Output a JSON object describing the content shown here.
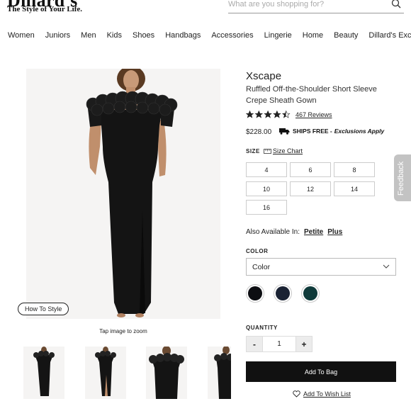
{
  "header": {
    "logo_text": "Dillard's",
    "logo_tagline": "The Style of Your Life.",
    "search_placeholder": "What are you shopping for?"
  },
  "nav": [
    "Women",
    "Juniors",
    "Men",
    "Kids",
    "Shoes",
    "Handbags",
    "Accessories",
    "Lingerie",
    "Home",
    "Beauty",
    "Dillard's Exclusive"
  ],
  "gallery": {
    "how_to_style": "How To Style",
    "tap_to_zoom": "Tap image to zoom"
  },
  "product": {
    "brand": "Xscape",
    "name": "Ruffled Off-the-Shoulder Short Sleeve Crepe Sheath Gown",
    "rating": 4.5,
    "reviews": "467 Reviews",
    "price": "$228.00",
    "shipping": "SHIPS FREE -",
    "shipping_note": "Exclusions Apply"
  },
  "size": {
    "label": "SIZE",
    "chart_label": "Size Chart",
    "options": [
      "4",
      "6",
      "8",
      "10",
      "12",
      "14",
      "16"
    ]
  },
  "also_available": {
    "label": "Also Available In:",
    "options": [
      "Petite",
      "Plus"
    ]
  },
  "color": {
    "label": "COLOR",
    "select_value": "Color",
    "swatches": [
      "#0d0e12",
      "#1a2233",
      "#0f3a3a"
    ]
  },
  "quantity": {
    "label": "QUANTITY",
    "minus": "-",
    "value": "1",
    "plus": "+"
  },
  "actions": {
    "add_to_bag": "Add To Bag",
    "wish_list": "Add To Wish List"
  },
  "feedback": "Feedback"
}
